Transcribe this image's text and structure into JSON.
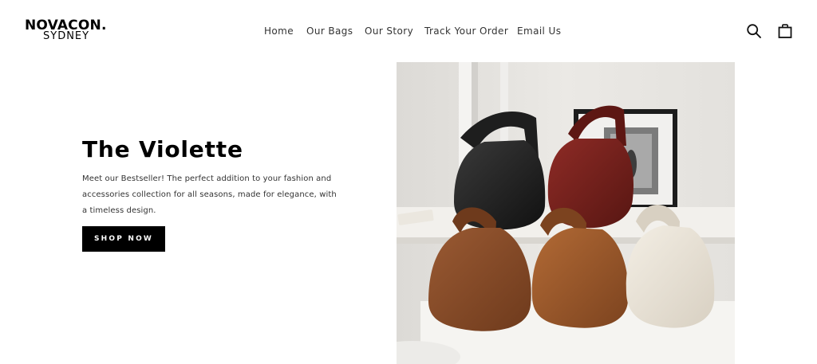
{
  "brand": {
    "name": "NOVACON.",
    "location": "SYDNEY"
  },
  "nav": {
    "items": [
      {
        "label": "Home"
      },
      {
        "label": "Our Bags"
      },
      {
        "label": "Our Story"
      },
      {
        "label": "Track Your Order"
      },
      {
        "label": "Email Us"
      }
    ]
  },
  "header_icons": {
    "search": "search-icon",
    "cart": "shopping-bag-icon"
  },
  "hero": {
    "title": "The Violette",
    "description": "Meet our Bestseller! The perfect addition to your fashion and accessories collection for all seasons, made for elegance, with a timeless design.",
    "cta_label": "SHOP NOW"
  },
  "colors": {
    "text": "#000000",
    "button_bg": "#000000",
    "button_text": "#ffffff",
    "background": "#ffffff"
  }
}
